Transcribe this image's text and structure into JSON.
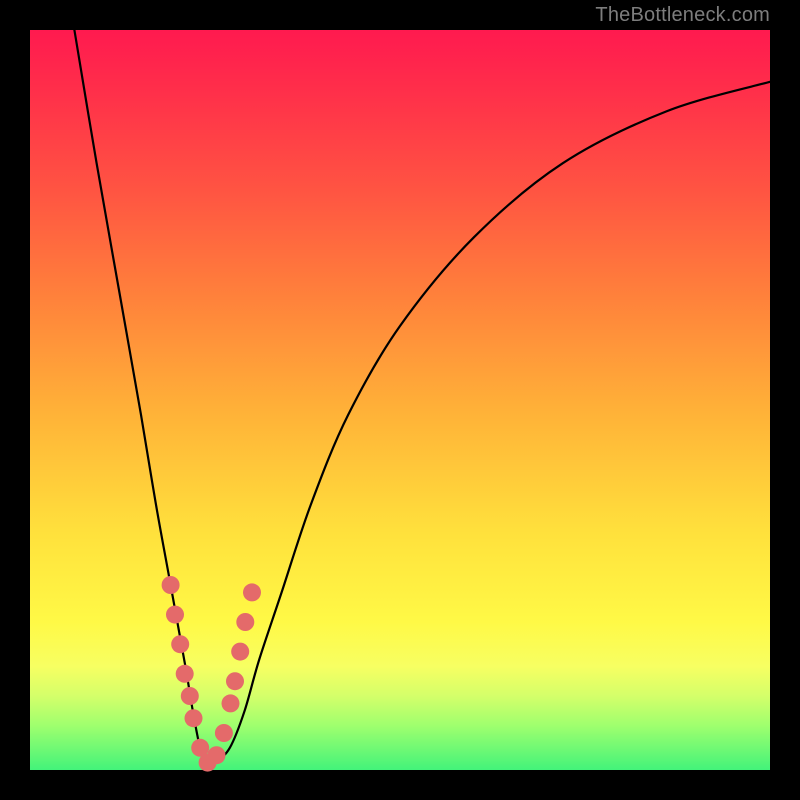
{
  "watermark": "TheBottleneck.com",
  "chart_data": {
    "type": "line",
    "title": "",
    "xlabel": "",
    "ylabel": "",
    "xlim": [
      0,
      100
    ],
    "ylim": [
      0,
      100
    ],
    "series": [
      {
        "name": "bottleneck-curve",
        "x": [
          6,
          9,
          12,
          15,
          17,
          19,
          21,
          22,
          23,
          24,
          25,
          27,
          29,
          31,
          34,
          38,
          43,
          50,
          60,
          72,
          86,
          100
        ],
        "y": [
          100,
          82,
          65,
          48,
          36,
          25,
          14,
          8,
          3,
          1,
          1,
          3,
          8,
          15,
          24,
          36,
          48,
          60,
          72,
          82,
          89,
          93
        ]
      }
    ],
    "markers": {
      "name": "highlight-dots",
      "color": "#e46a6a",
      "x": [
        19.0,
        19.6,
        20.3,
        20.9,
        21.6,
        22.1,
        23.0,
        24.0,
        25.2,
        26.2,
        27.1,
        27.7,
        28.4,
        29.1,
        30.0
      ],
      "y": [
        25,
        21,
        17,
        13,
        10,
        7,
        3,
        1,
        2,
        5,
        9,
        12,
        16,
        20,
        24
      ]
    },
    "gradient_stops": [
      {
        "pos": 0.0,
        "color": "#ff1a4f"
      },
      {
        "pos": 0.36,
        "color": "#ff813b"
      },
      {
        "pos": 0.68,
        "color": "#ffe13c"
      },
      {
        "pos": 0.9,
        "color": "#d4ff6a"
      },
      {
        "pos": 1.0,
        "color": "#43f37a"
      }
    ]
  }
}
